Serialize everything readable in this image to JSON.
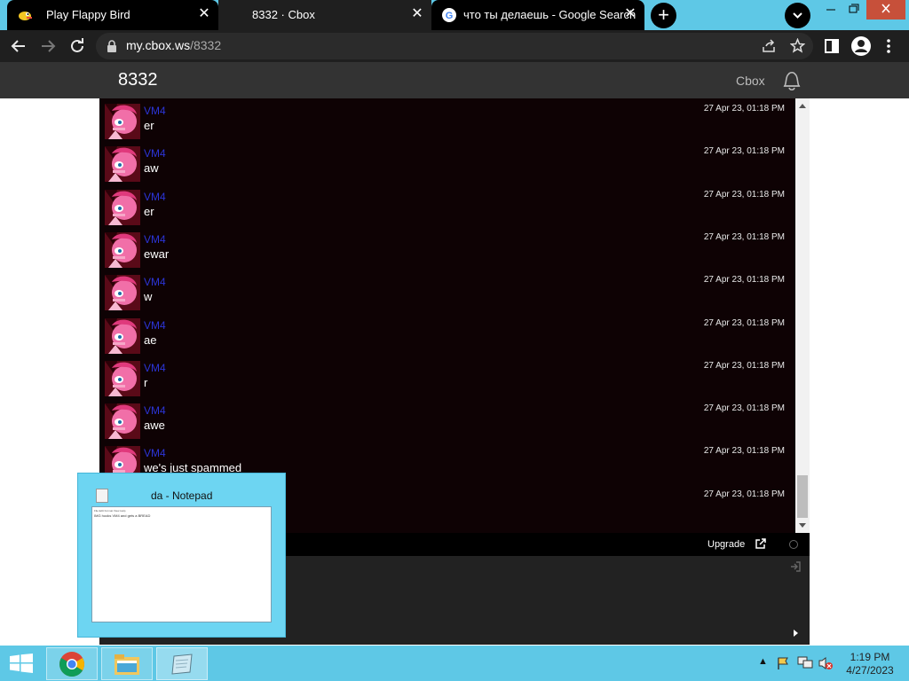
{
  "browser": {
    "tabs": [
      {
        "title": "Play Flappy Bird",
        "icon": "flappy-bird-favicon"
      },
      {
        "title": "8332 · Cbox",
        "icon": "cbox-favicon"
      },
      {
        "title": "что ты делаешь - Google Search",
        "icon": "google-favicon"
      }
    ],
    "close_glyph": "✕",
    "new_tab_glyph": "+",
    "address": {
      "host": "my.cbox.ws",
      "path": "/8332"
    }
  },
  "site": {
    "box_name": "8332",
    "brand": "Cbox"
  },
  "messages": [
    {
      "user": "VM4",
      "text": "er",
      "time": "27 Apr 23, 01:18 PM"
    },
    {
      "user": "VM4",
      "text": "aw",
      "time": "27 Apr 23, 01:18 PM"
    },
    {
      "user": "VM4",
      "text": "er",
      "time": "27 Apr 23, 01:18 PM"
    },
    {
      "user": "VM4",
      "text": "ewar",
      "time": "27 Apr 23, 01:18 PM"
    },
    {
      "user": "VM4",
      "text": "w",
      "time": "27 Apr 23, 01:18 PM"
    },
    {
      "user": "VM4",
      "text": "ae",
      "time": "27 Apr 23, 01:18 PM"
    },
    {
      "user": "VM4",
      "text": "r",
      "time": "27 Apr 23, 01:18 PM"
    },
    {
      "user": "VM4",
      "text": "awe",
      "time": "27 Apr 23, 01:18 PM"
    },
    {
      "user": "VM4",
      "text": "we's just spammed",
      "time": "27 Apr 23, 01:18 PM"
    },
    {
      "user": "",
      "text": "",
      "time": "27 Apr 23, 01:18 PM"
    }
  ],
  "footer": {
    "upgrade_label": "Upgrade"
  },
  "notepad_preview": {
    "title": "da - Notepad",
    "menu": "File  Edit  Format  View  Help",
    "content": "IMG hooks VM4 and gets a BREAD"
  },
  "taskbar": {
    "apps": [
      "chrome-icon",
      "file-explorer-icon",
      "notepad-icon"
    ],
    "time": "1:19 PM",
    "date": "4/27/2023"
  },
  "colors": {
    "username": "#2c35d8",
    "chat_background": "#0e0204",
    "taskbar": "#5ec8e6"
  }
}
